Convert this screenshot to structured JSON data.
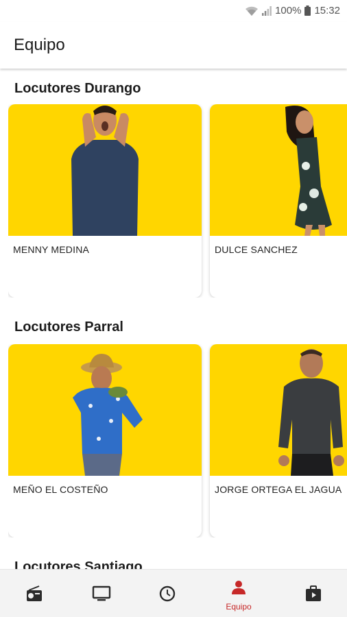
{
  "status": {
    "battery": "100%",
    "time": "15:32"
  },
  "header": {
    "title": "Equipo"
  },
  "sections": [
    {
      "title": "Locutores Durango",
      "cards": [
        {
          "name": "MENNY MEDINA"
        },
        {
          "name": "DULCE SANCHEZ"
        }
      ]
    },
    {
      "title": "Locutores Parral",
      "cards": [
        {
          "name": "MEÑO EL COSTEÑO"
        },
        {
          "name": "JORGE ORTEGA EL JAGUA"
        }
      ]
    },
    {
      "title": "Locutores Santiago"
    }
  ],
  "nav": {
    "items": [
      {
        "icon": "radio-icon"
      },
      {
        "icon": "tv-icon"
      },
      {
        "icon": "clock-icon"
      },
      {
        "icon": "person-icon",
        "label": "Equipo",
        "active": true
      },
      {
        "icon": "video-bag-icon"
      }
    ]
  },
  "colors": {
    "accent": "#c62828",
    "card_bg": "#ffd600",
    "nav_inactive": "#2b2b2b"
  }
}
